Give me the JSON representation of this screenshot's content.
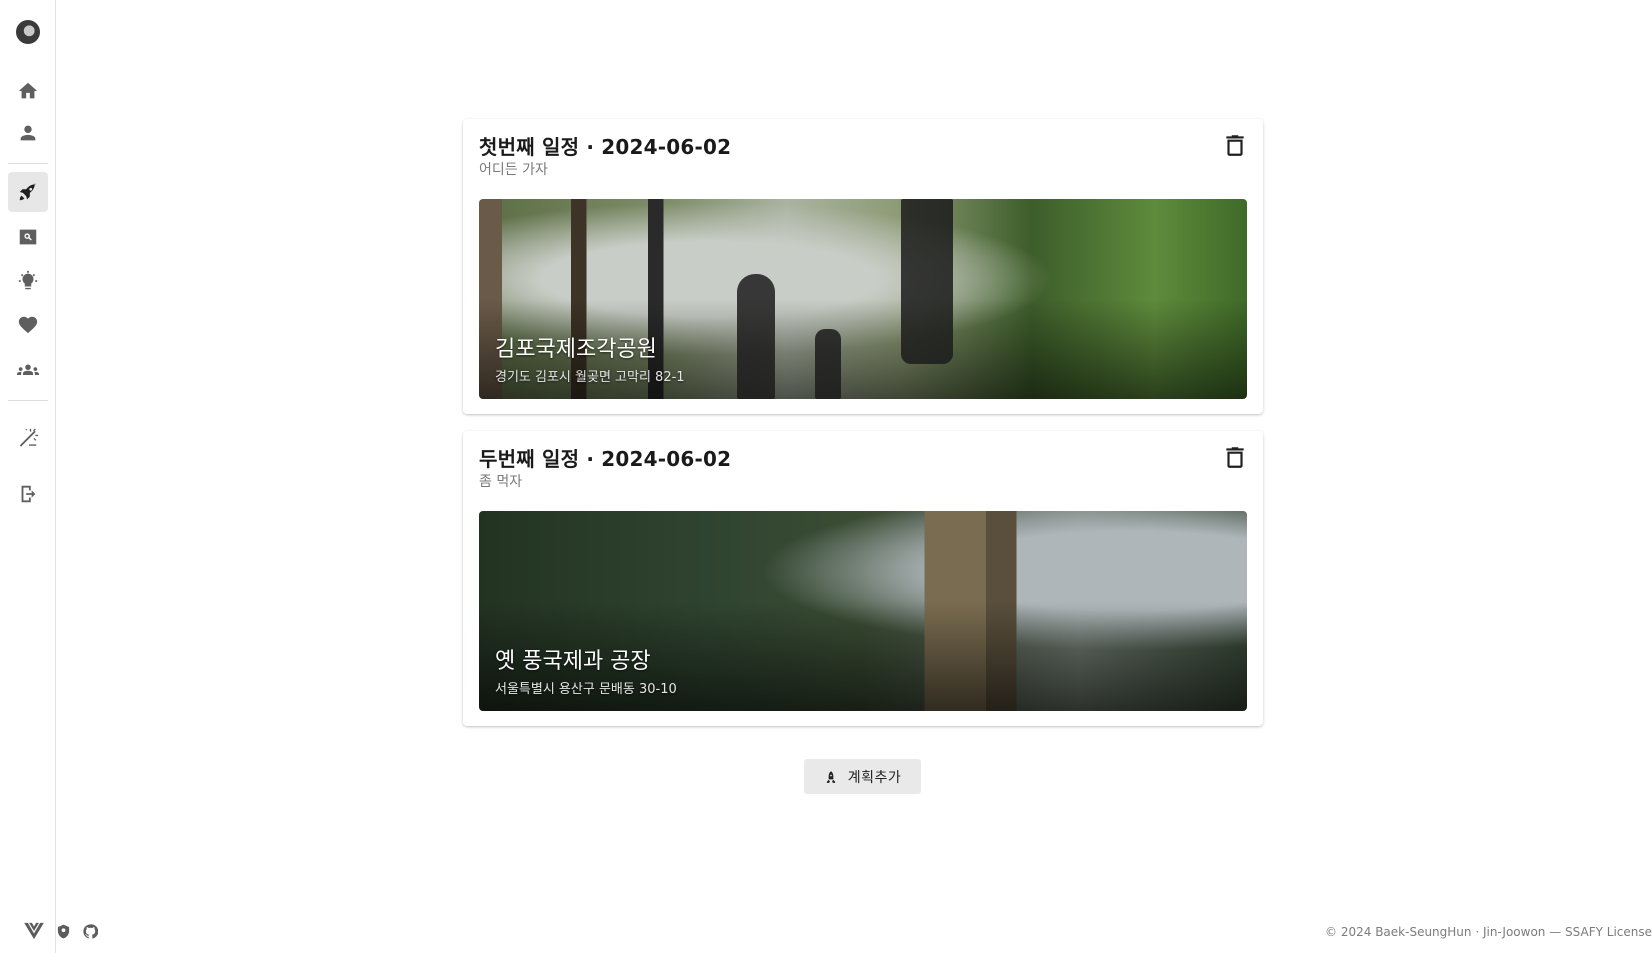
{
  "sidebar": {
    "avatar": "user-avatar",
    "items": [
      {
        "icon": "home-icon",
        "active": false
      },
      {
        "icon": "person-icon",
        "active": false
      },
      {
        "icon": "rocket-icon",
        "active": true
      },
      {
        "icon": "search-icon",
        "active": false
      },
      {
        "icon": "lightbulb-icon",
        "active": false
      },
      {
        "icon": "heart-icon",
        "active": false
      },
      {
        "icon": "group-icon",
        "active": false
      },
      {
        "icon": "wand-icon",
        "active": false
      },
      {
        "icon": "logout-icon",
        "active": false
      }
    ]
  },
  "plans": [
    {
      "title": "첫번째 일정 · 2024-06-02",
      "subtitle": "어디든 가자",
      "place_name": "김포국제조각공원",
      "place_address": "경기도 김포시 월곶면 고막리 82-1"
    },
    {
      "title": "두번째 일정 · 2024-06-02",
      "subtitle": "좀 먹자",
      "place_name": "옛 풍국제과 공장",
      "place_address": "서울특별시 용산구 문배동 30-10"
    }
  ],
  "add_button": {
    "label": "계획추가",
    "icon": "rocket-icon"
  },
  "footer": {
    "icons": [
      "vue-icon",
      "shield-icon",
      "github-icon"
    ],
    "copyright": "© 2024 Baek-SeungHun · Jin-Joowon — SSAFY License"
  },
  "colors": {
    "active_nav_bg": "#e7e7e7",
    "button_bg": "#e9e9e9",
    "icon": "#5f5f5f"
  }
}
